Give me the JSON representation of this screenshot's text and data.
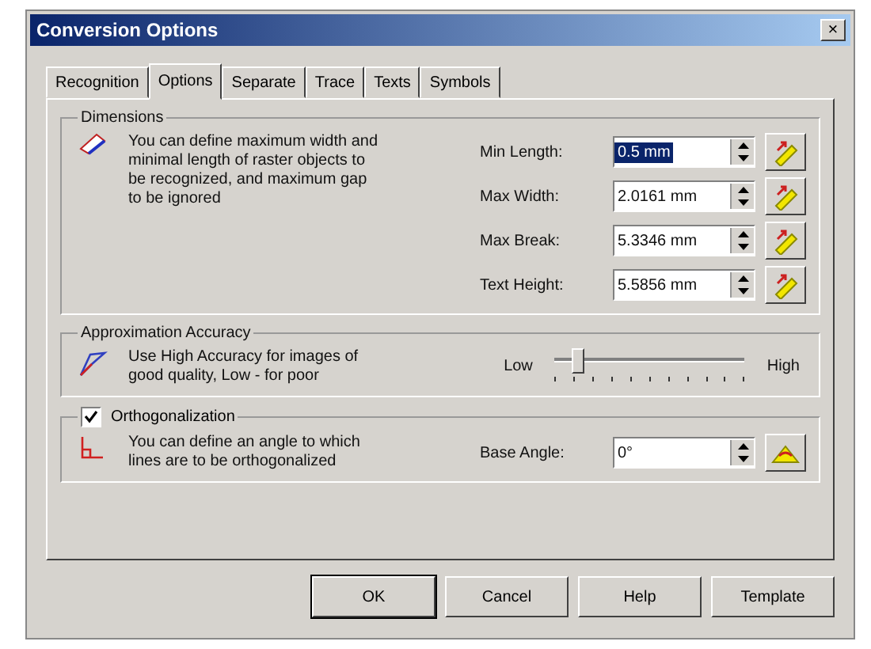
{
  "window": {
    "title": "Conversion Options",
    "close": "×"
  },
  "tabs": [
    {
      "label": "Recognition",
      "selected": false
    },
    {
      "label": "Options",
      "selected": true
    },
    {
      "label": "Separate",
      "selected": false
    },
    {
      "label": "Trace",
      "selected": false
    },
    {
      "label": "Texts",
      "selected": false
    },
    {
      "label": "Symbols",
      "selected": false
    }
  ],
  "dimensions": {
    "title": "Dimensions",
    "description": "You can define maximum width and minimal length of raster objects to be recognized, and maximum gap to be ignored",
    "fields": [
      {
        "label": "Min Length:",
        "value": "0.5 mm",
        "selected": true
      },
      {
        "label": "Max Width:",
        "value": "2.0161 mm",
        "selected": false
      },
      {
        "label": "Max Break:",
        "value": "5.3346 mm",
        "selected": false
      },
      {
        "label": "Text Height:",
        "value": "5.5856 mm",
        "selected": false
      }
    ]
  },
  "accuracy": {
    "title": "Approximation Accuracy",
    "description": "Use High Accuracy for images of good quality, Low - for poor",
    "low_label": "Low",
    "high_label": "High",
    "level": 0.12
  },
  "orthogonalization": {
    "title": "Orthogonalization",
    "checked": true,
    "description": "You can define an angle to which lines are to be orthogonalized",
    "label": "Base Angle:",
    "value": "0°"
  },
  "buttons": [
    "OK",
    "Cancel",
    "Help",
    "Template"
  ]
}
